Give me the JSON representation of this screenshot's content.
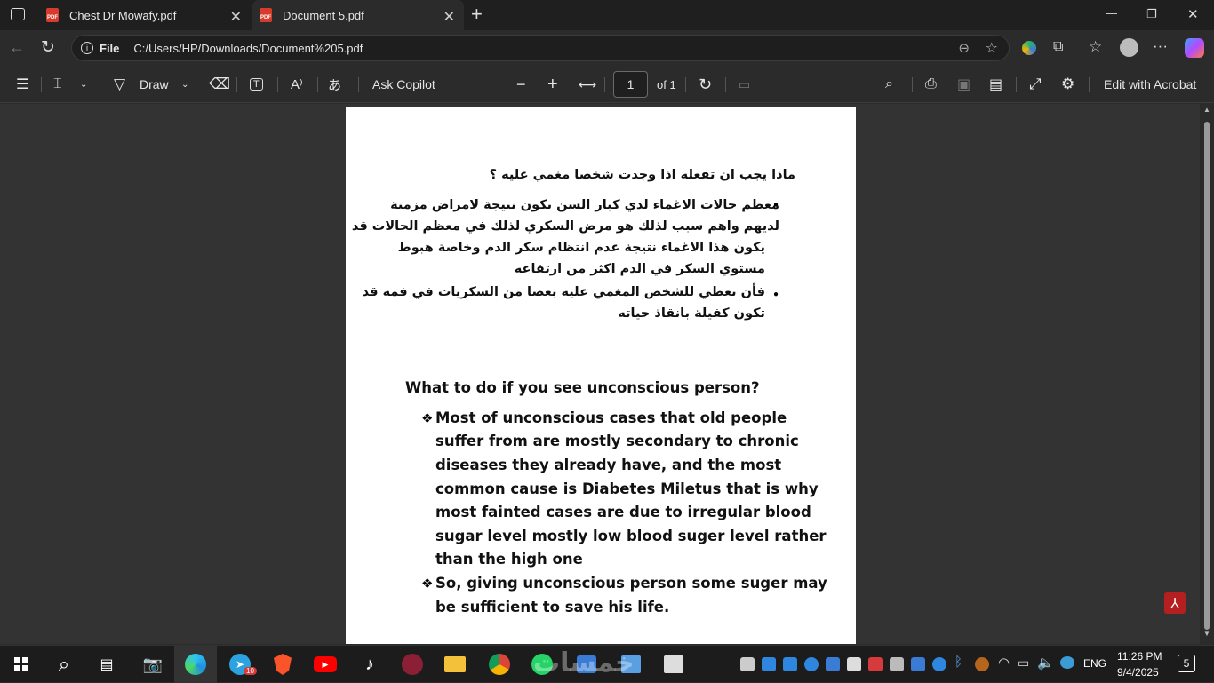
{
  "tabs": [
    {
      "title": "Chest Dr Mowafy.pdf",
      "close": "✕",
      "icon": "PDF"
    },
    {
      "title": "Document 5.pdf",
      "close": "✕",
      "icon": "PDF"
    }
  ],
  "new_tab": "+",
  "window_controls": {
    "minimize": "—",
    "restore": "❐",
    "close": "✕"
  },
  "address": {
    "scheme_label": "File",
    "url": "C:/Users/HP/Downloads/Document%205.pdf"
  },
  "pdf_toolbar": {
    "draw_label": "Draw",
    "ask_copilot": "Ask Copilot",
    "zoom_out": "−",
    "zoom_in": "+",
    "page_number": "1",
    "page_total": "of 1",
    "edit_acrobat": "Edit with Acrobat"
  },
  "document": {
    "arabic_title": "ماذا يجب ان تفعله اذا وجدت شخصا مغمي عليه ؟",
    "arabic_bullets": [
      [
        "معظم حالات الاغماء لدي كبار السن تكون نتيجة لامراض مزمنة",
        "لديهم واهم سبب لذلك هو مرض السكري لذلك في معظم الحالات قد",
        "يكون هذا الاغماء نتيجة عدم انتظام سكر الدم وخاصة هبوط",
        "مستوي السكر في الدم اكثر من ارتفاعه"
      ],
      [
        "فأن تعطي للشخص المغمي عليه بعضا من السكريات في فمه قد",
        "تكون كفيلة بانقاذ حياته"
      ]
    ],
    "english_title": "What to do if you see unconscious person?",
    "english_bullets": [
      [
        "Most of unconscious cases that old people",
        "suffer from are mostly secondary to chronic",
        "diseases they already have, and the most",
        "common cause is Diabetes Miletus that is why",
        "most fainted cases are due to irregular blood",
        "sugar level mostly low blood suger level rather",
        "than the high one"
      ],
      [
        "So, giving unconscious person some suger may",
        "be sufficient to save his life."
      ]
    ],
    "bullet_glyph": "❖",
    "arabic_bullet_glyph": "●"
  },
  "taskbar": {
    "language": "ENG",
    "time": "11:26 PM",
    "date": "9/4/2025",
    "notification_count": "5",
    "telegram_badge": "10",
    "watermark": "خمسات"
  },
  "colors": {
    "acrobat_red": "#b51f1f",
    "pdf_red": "#d83b2b",
    "edge_blue": "#1f8fe0"
  }
}
